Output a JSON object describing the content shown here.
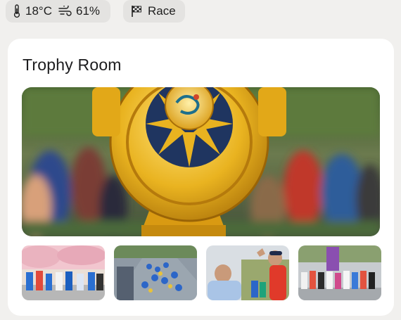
{
  "status_chips": {
    "weather": {
      "temperature": "18°C",
      "humidity": "61%",
      "temperature_icon": "thermometer-icon",
      "humidity_icon": "wind-icon"
    },
    "race": {
      "label": "Race",
      "icon": "checkered-flag-icon"
    }
  },
  "trophy_room": {
    "title": "Trophy Room",
    "featured_image": "trophy-medal-photo",
    "thumbnails": [
      {
        "name": "thumbnail-runners-cherry-blossom"
      },
      {
        "name": "thumbnail-crowd-street-race"
      },
      {
        "name": "thumbnail-high-five-spectator"
      },
      {
        "name": "thumbnail-runners-finish-banner"
      }
    ]
  },
  "colors": {
    "background": "#f1f0ee",
    "card": "#ffffff",
    "chip": "#e4e3e1",
    "gold": "#e9b320",
    "text": "#1c1c1e"
  }
}
